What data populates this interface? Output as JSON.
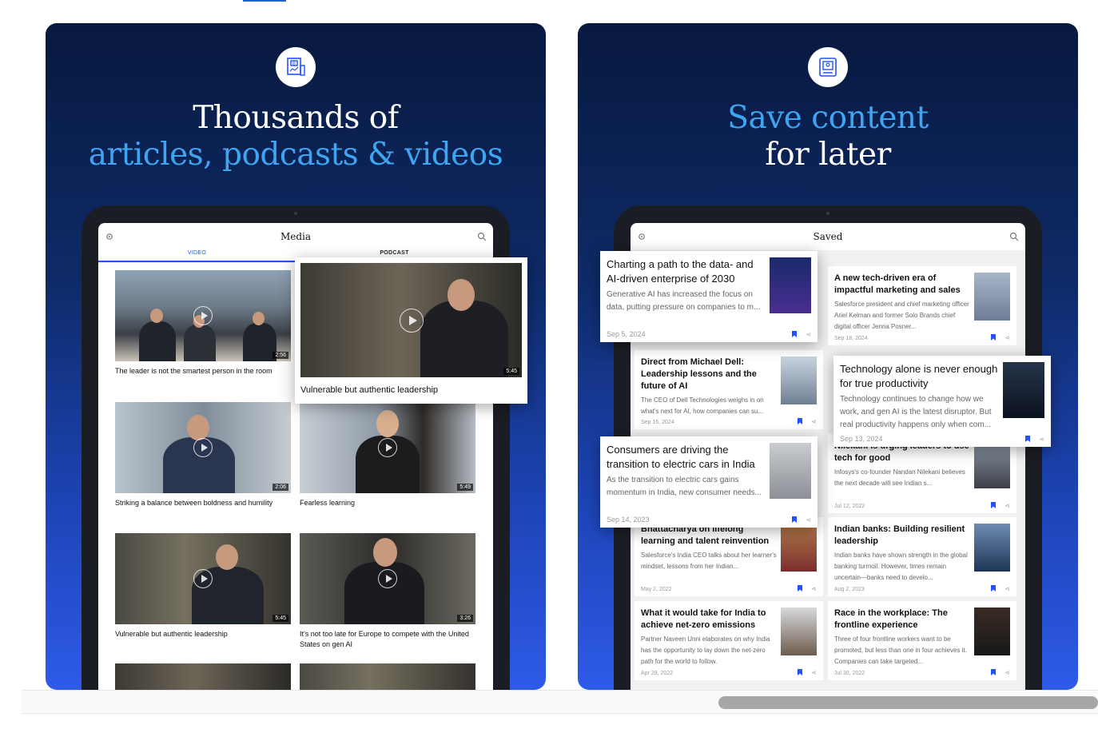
{
  "left_panel": {
    "headline_line1": "Thousands of",
    "headline_line2": "articles, podcasts & videos",
    "app_title": "Media",
    "tabs": [
      "VIDEO",
      "PODCAST"
    ],
    "videos": [
      {
        "title": "The leader is not the smartest person in the room",
        "duration": "2:56"
      },
      {
        "title": "Striking a balance between boldness and humility",
        "duration": "2:06"
      },
      {
        "title": "Fearless learning",
        "duration": "5:49"
      },
      {
        "title": "Vulnerable but authentic leadership",
        "duration": "5:45"
      },
      {
        "title": "It's not too late for Europe to compete with the United States on gen AI",
        "duration": "3:26"
      }
    ],
    "featured": {
      "title": "Vulnerable but authentic leadership",
      "duration": "5:45"
    }
  },
  "right_panel": {
    "headline_line1": "Save content",
    "headline_line2": "for later",
    "app_title": "Saved",
    "cards": [
      {
        "title": "Direct from Michael Dell: Leadership lessons and the future of AI",
        "desc": "The CEO of Dell Technologies weighs in on what's next for AI, how companies can su...",
        "date": "Sep 16, 2024"
      },
      {
        "title": "A new tech-driven era of impactful marketing and sales",
        "desc": "Salesforce president and chief marketing officer Ariel Kelman and former Solo Brands chief digital officer Jenna Posner...",
        "date": "Sep 18, 2024"
      },
      {
        "title": "Nilekani is urging leaders to use tech for good",
        "desc": "Infosys's co-founder Nandan Nilekani believes the next decade will see Indian s...",
        "date": "Jul 12, 2022"
      },
      {
        "title": "Bhattacharya on lifelong learning and talent reinvention",
        "desc": "Salesforce's India CEO talks about her learner's mindset, lessons from her Indian...",
        "date": "May 2, 2022"
      },
      {
        "title": "Indian banks: Building resilient leadership",
        "desc": "Indian banks have shown strength in the global banking turmoil. However, times remain uncertain—banks need to develo...",
        "date": "Aug 2, 2023"
      },
      {
        "title": "What it would take for India to achieve net-zero emissions",
        "desc": "Partner Naveen Unni elaborates on why India has the opportunity to lay down the net-zero path for the world to follow.",
        "date": "Apr 29, 2022"
      },
      {
        "title": "Race in the workplace: The frontline experience",
        "desc": "Three of four frontline workers want to be promoted, but less than one in four achieves it. Companies can take targeted...",
        "date": "Jul 30, 2022"
      }
    ],
    "popups": [
      {
        "title": "Charting a path to the data- and AI-driven enterprise of 2030",
        "desc": "Generative AI has increased the focus on data, putting pressure on companies to m...",
        "date": "Sep 5, 2024"
      },
      {
        "title": "Technology alone is never enough for true productivity",
        "desc": "Technology continues to change how we work, and gen AI is the latest disruptor. But real productivity happens only when com...",
        "date": "Sep 13, 2024"
      },
      {
        "title": "Consumers are driving the transition to electric cars in India",
        "desc": "As the transition to electric cars gains momentum in India, new consumer needs...",
        "date": "Sep 14, 2023"
      }
    ]
  },
  "colors": {
    "accent": "#2251ff",
    "headline_blue": "#3fa4f2",
    "panel_dark": "#08193f",
    "panel_light": "#2e5ae8"
  }
}
